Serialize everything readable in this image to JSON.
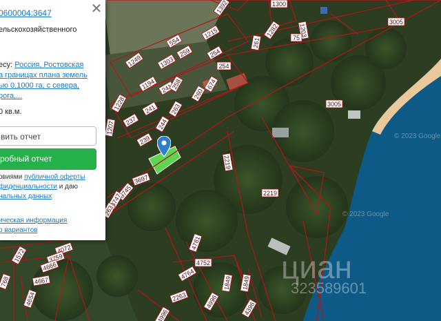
{
  "panel": {
    "cadastral_number": "0600004:3647",
    "category": "ельскохозяйственного",
    "address_label": "есу:",
    "address_link": "Россия, Ростовская\nа границах плана земель\nью 0,1000 га, с севера,\nрога,...",
    "area": "0 кв.м.",
    "order_report_button": "вить отчет",
    "detailed_report_button": "робный отчет",
    "terms_prefix": "овиями",
    "terms_link": "публичной оферты",
    "terms_middle": "фиденциальности",
    "terms_suffix": "и даю",
    "terms_line3": "нальных данных",
    "info_link": "ическая информация",
    "options_link": "р вариантов"
  },
  "map": {
    "parcel_labels": {
      "p1392": "1392",
      "p1300": "1300",
      "p3005a": "3005",
      "p1215": "1215",
      "p1282": "1282",
      "p1203": "1203",
      "p554": "554",
      "p261": "261",
      "p75": "75",
      "p1249": "1249",
      "p1303": "1303",
      "p259": "259",
      "p254a": "254",
      "p254b": "254",
      "p1194": "1194",
      "p241": "241",
      "p258": "258",
      "p674": "674",
      "p260": "260",
      "p1228": "1228",
      "p3005b": "3005",
      "p263": "263",
      "p237": "237",
      "p1207": "1207",
      "p244": "244",
      "p239": "239",
      "p2219a": "2219",
      "p2219b": "2219",
      "p3697": "3697",
      "p3745": "3745",
      "p3747": "3747",
      "p263b": "263",
      "p4072": "4072",
      "p1572": "1572",
      "p3759": "3759",
      "p4666": "4666",
      "p4667": "4667",
      "p768": "768",
      "p4654": "4654",
      "p4781": "4781",
      "p4752": "4752",
      "p4764": "4764",
      "p1849a": "1849",
      "p1849b": "1849",
      "p2263": "2263",
      "p4996a": "4996",
      "p4396": "4396",
      "p4996b": "4996"
    }
  },
  "watermark": {
    "brand": "циан",
    "listing_id": "323589601",
    "copyright_1": "© 2023 Google",
    "copyright_2": "© 2023 Google"
  },
  "colors": {
    "parcel_border": "#b0161a",
    "label_bg": "#ffffff",
    "selected_parcel": "#5fd44e",
    "pin": "#2f7ec9",
    "water": "#0e5a86",
    "beach": "#e9c89c",
    "link": "#1a7ac4",
    "green_button": "#25b04a"
  }
}
